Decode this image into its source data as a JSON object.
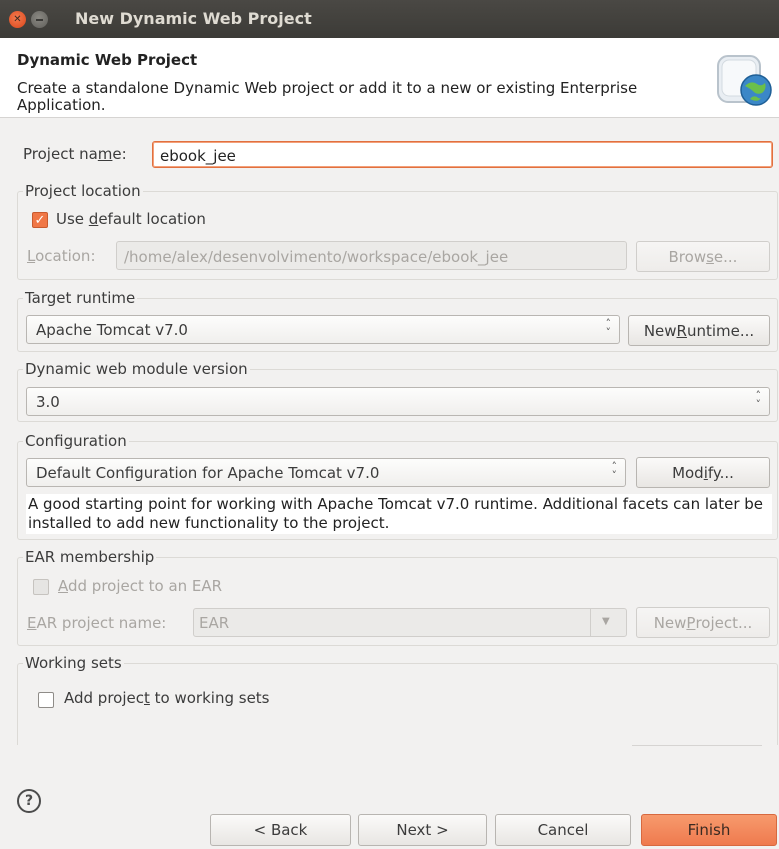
{
  "window": {
    "title": "New Dynamic Web Project",
    "controls": {
      "close_icon": "close-icon",
      "minimize_icon": "minimize-icon"
    }
  },
  "header": {
    "title": "Dynamic Web Project",
    "description": "Create a standalone Dynamic Web project or add it to a new or existing Enterprise Application.",
    "icon": "web-project-globe-icon"
  },
  "project_name": {
    "label_pre": "Project na",
    "label_mnemonic": "m",
    "label_post": "e:",
    "value": "ebook_jee"
  },
  "project_location": {
    "title": "Project location",
    "use_default": {
      "pre": "Use ",
      "mnemonic": "d",
      "post": "efault location",
      "checked": true
    },
    "location_label_mnemonic": "L",
    "location_label_rest": "ocation:",
    "location_value": "/home/alex/desenvolvimento/workspace/ebook_jee",
    "browse_pre": "Brow",
    "browse_mnemonic": "s",
    "browse_post": "e..."
  },
  "target_runtime": {
    "title": "Target runtime",
    "selected": "Apache Tomcat v7.0",
    "new_runtime_pre": "New ",
    "new_runtime_mnemonic": "R",
    "new_runtime_post": "untime..."
  },
  "module_version": {
    "title": "Dynamic web module version",
    "selected": "3.0"
  },
  "configuration": {
    "title": "Configuration",
    "selected": "Default Configuration for Apache Tomcat v7.0",
    "modify_pre": "Mod",
    "modify_mnemonic": "i",
    "modify_post": "fy...",
    "description": "A good starting point for working with Apache Tomcat v7.0 runtime. Additional facets can later be installed to add new functionality to the project."
  },
  "ear": {
    "title": "EAR membership",
    "add_mnemonic": "A",
    "add_rest": "dd project to an EAR",
    "add_checked": false,
    "name_label_mnemonic": "E",
    "name_label_rest": "AR project name:",
    "name_value": "EAR",
    "new_project_pre": "New ",
    "new_project_mnemonic": "P",
    "new_project_post": "roject..."
  },
  "working_sets": {
    "title": "Working sets",
    "add_pre": "Add projec",
    "add_mnemonic": "t",
    "add_post": " to working sets",
    "add_checked": false
  },
  "footer": {
    "help_icon": "help-icon",
    "help_glyph": "?",
    "back": "< Back",
    "next": "Next >",
    "cancel": "Cancel",
    "finish": "Finish"
  }
}
